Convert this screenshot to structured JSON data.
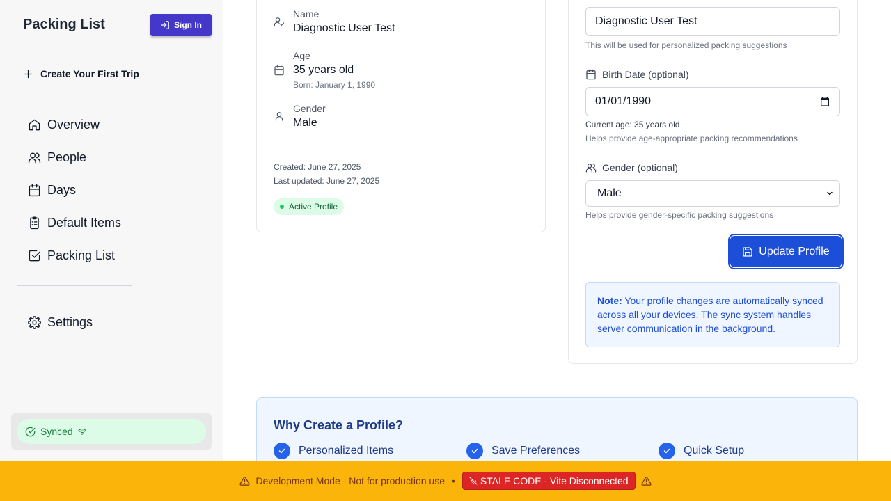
{
  "sidebar": {
    "brand": "Packing List",
    "signin_label": "Sign In",
    "create_trip_label": "Create Your First Trip",
    "nav": [
      {
        "label": "Overview",
        "icon": "home-icon"
      },
      {
        "label": "People",
        "icon": "users-icon"
      },
      {
        "label": "Days",
        "icon": "calendar-icon"
      },
      {
        "label": "Default Items",
        "icon": "clipboard-list-icon"
      },
      {
        "label": "Packing List",
        "icon": "check-square-icon"
      }
    ],
    "settings_label": "Settings",
    "sync_status": "Synced"
  },
  "profile_card": {
    "name_label": "Name",
    "name_value": "Diagnostic User Test",
    "age_label": "Age",
    "age_value": "35 years old",
    "born": "Born: January 1, 1990",
    "gender_label": "Gender",
    "gender_value": "Male",
    "created": "Created: June 27, 2025",
    "updated": "Last updated: June 27, 2025",
    "status_badge": "Active Profile"
  },
  "edit_form": {
    "name_value": "Diagnostic User Test",
    "name_help": "This will be used for personalized packing suggestions",
    "birth_label": "Birth Date (optional)",
    "birth_value": "01/01/1990",
    "current_age": "Current age: 35 years old",
    "birth_help": "Helps provide age-appropriate packing recommendations",
    "gender_label": "Gender (optional)",
    "gender_value": "Male",
    "gender_help": "Helps provide gender-specific packing suggestions",
    "update_label": "Update Profile",
    "note_bold": "Note:",
    "note_text": " Your profile changes are automatically synced across all your devices. The sync system handles server communication in the background."
  },
  "why": {
    "title": "Why Create a Profile?",
    "items": [
      "Personalized Items",
      "Save Preferences",
      "Quick Setup"
    ]
  },
  "devbar": {
    "message": "Development Mode - Not for production use",
    "separator": "•",
    "stale_label": "STALE CODE - Vite Disconnected"
  },
  "colors": {
    "accent": "#1d4ed8",
    "signin": "#4338ca",
    "devbar": "#fbb40a",
    "stale": "#dc2626",
    "success": "#22c55e"
  }
}
